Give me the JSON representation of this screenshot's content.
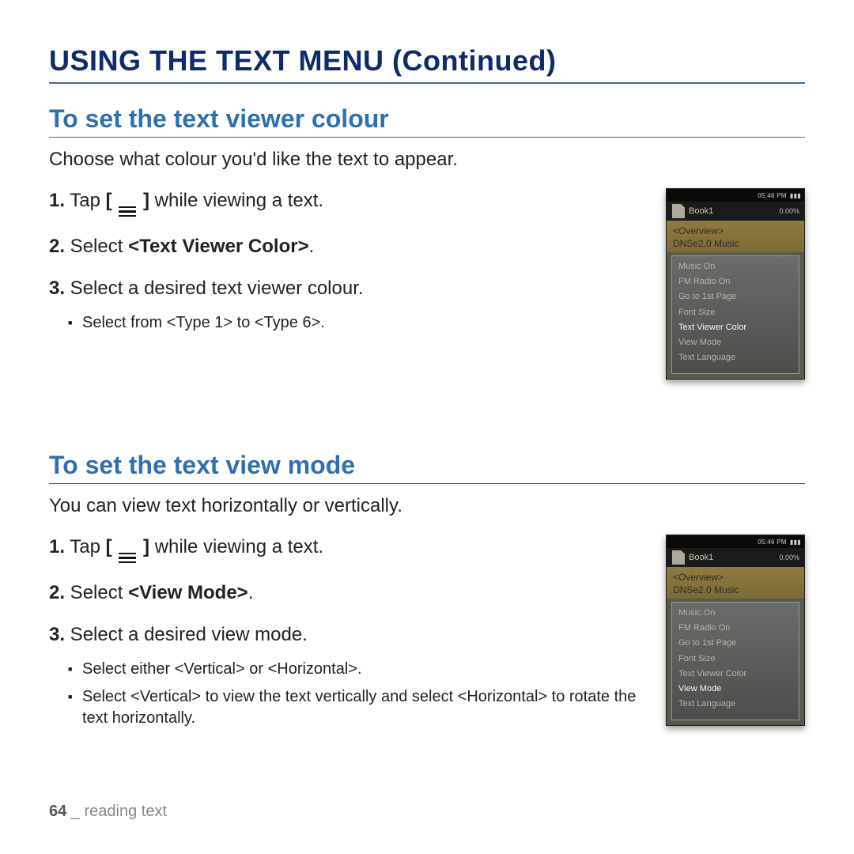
{
  "page_title": "USING THE TEXT MENU (Continued)",
  "footer": {
    "page_num": "64",
    "sep": " _ ",
    "chapter": "reading text"
  },
  "menu_icon": "hamburger",
  "section1": {
    "heading": "To set the text viewer colour",
    "intro": "Choose what colour you'd like the text to appear.",
    "step1_num": "1.",
    "step1_a": " Tap ",
    "step1_b": "[ ",
    "step1_c": " ]",
    "step1_d": " while viewing a text.",
    "step2_num": "2.",
    "step2_a": " Select ",
    "step2_bold": "<Text Viewer Color>",
    "step2_end": ".",
    "step3_num": "3.",
    "step3_a": " Select a desired text viewer colour.",
    "sub1": "Select from <Type 1> to <Type 6>.",
    "device": {
      "time": "05:46 PM",
      "batt": "▮▮▮",
      "title": "Book1",
      "pct": "0.00%",
      "overview": "<Overview>",
      "dnse": "DNSe2.0 Music",
      "items": [
        "Music On",
        "FM Radio On",
        "Go to 1st Page",
        "Font Size",
        "Text Viewer Color",
        "View Mode",
        "Text Language"
      ],
      "selected_index": 4
    }
  },
  "section2": {
    "heading": "To set the text view mode",
    "intro": "You can view text horizontally or vertically.",
    "step1_num": "1.",
    "step1_a": " Tap ",
    "step1_b": "[ ",
    "step1_c": " ]",
    "step1_d": " while viewing a text.",
    "step2_num": "2.",
    "step2_a": " Select ",
    "step2_bold": "<View Mode>",
    "step2_end": ".",
    "step3_num": "3.",
    "step3_a": " Select a desired view mode.",
    "sub1": "Select either <Vertical> or <Horizontal>.",
    "sub2": "Select <Vertical> to view the text vertically and select <Horizontal> to rotate the text horizontally.",
    "device": {
      "time": "05:46 PM",
      "batt": "▮▮▮",
      "title": "Book1",
      "pct": "0.00%",
      "overview": "<Overview>",
      "dnse": "DNSe2.0 Music",
      "items": [
        "Music On",
        "FM Radio On",
        "Go to 1st Page",
        "Font Size",
        "Text Viewer Color",
        "View Mode",
        "Text Language"
      ],
      "selected_index": 5
    }
  }
}
